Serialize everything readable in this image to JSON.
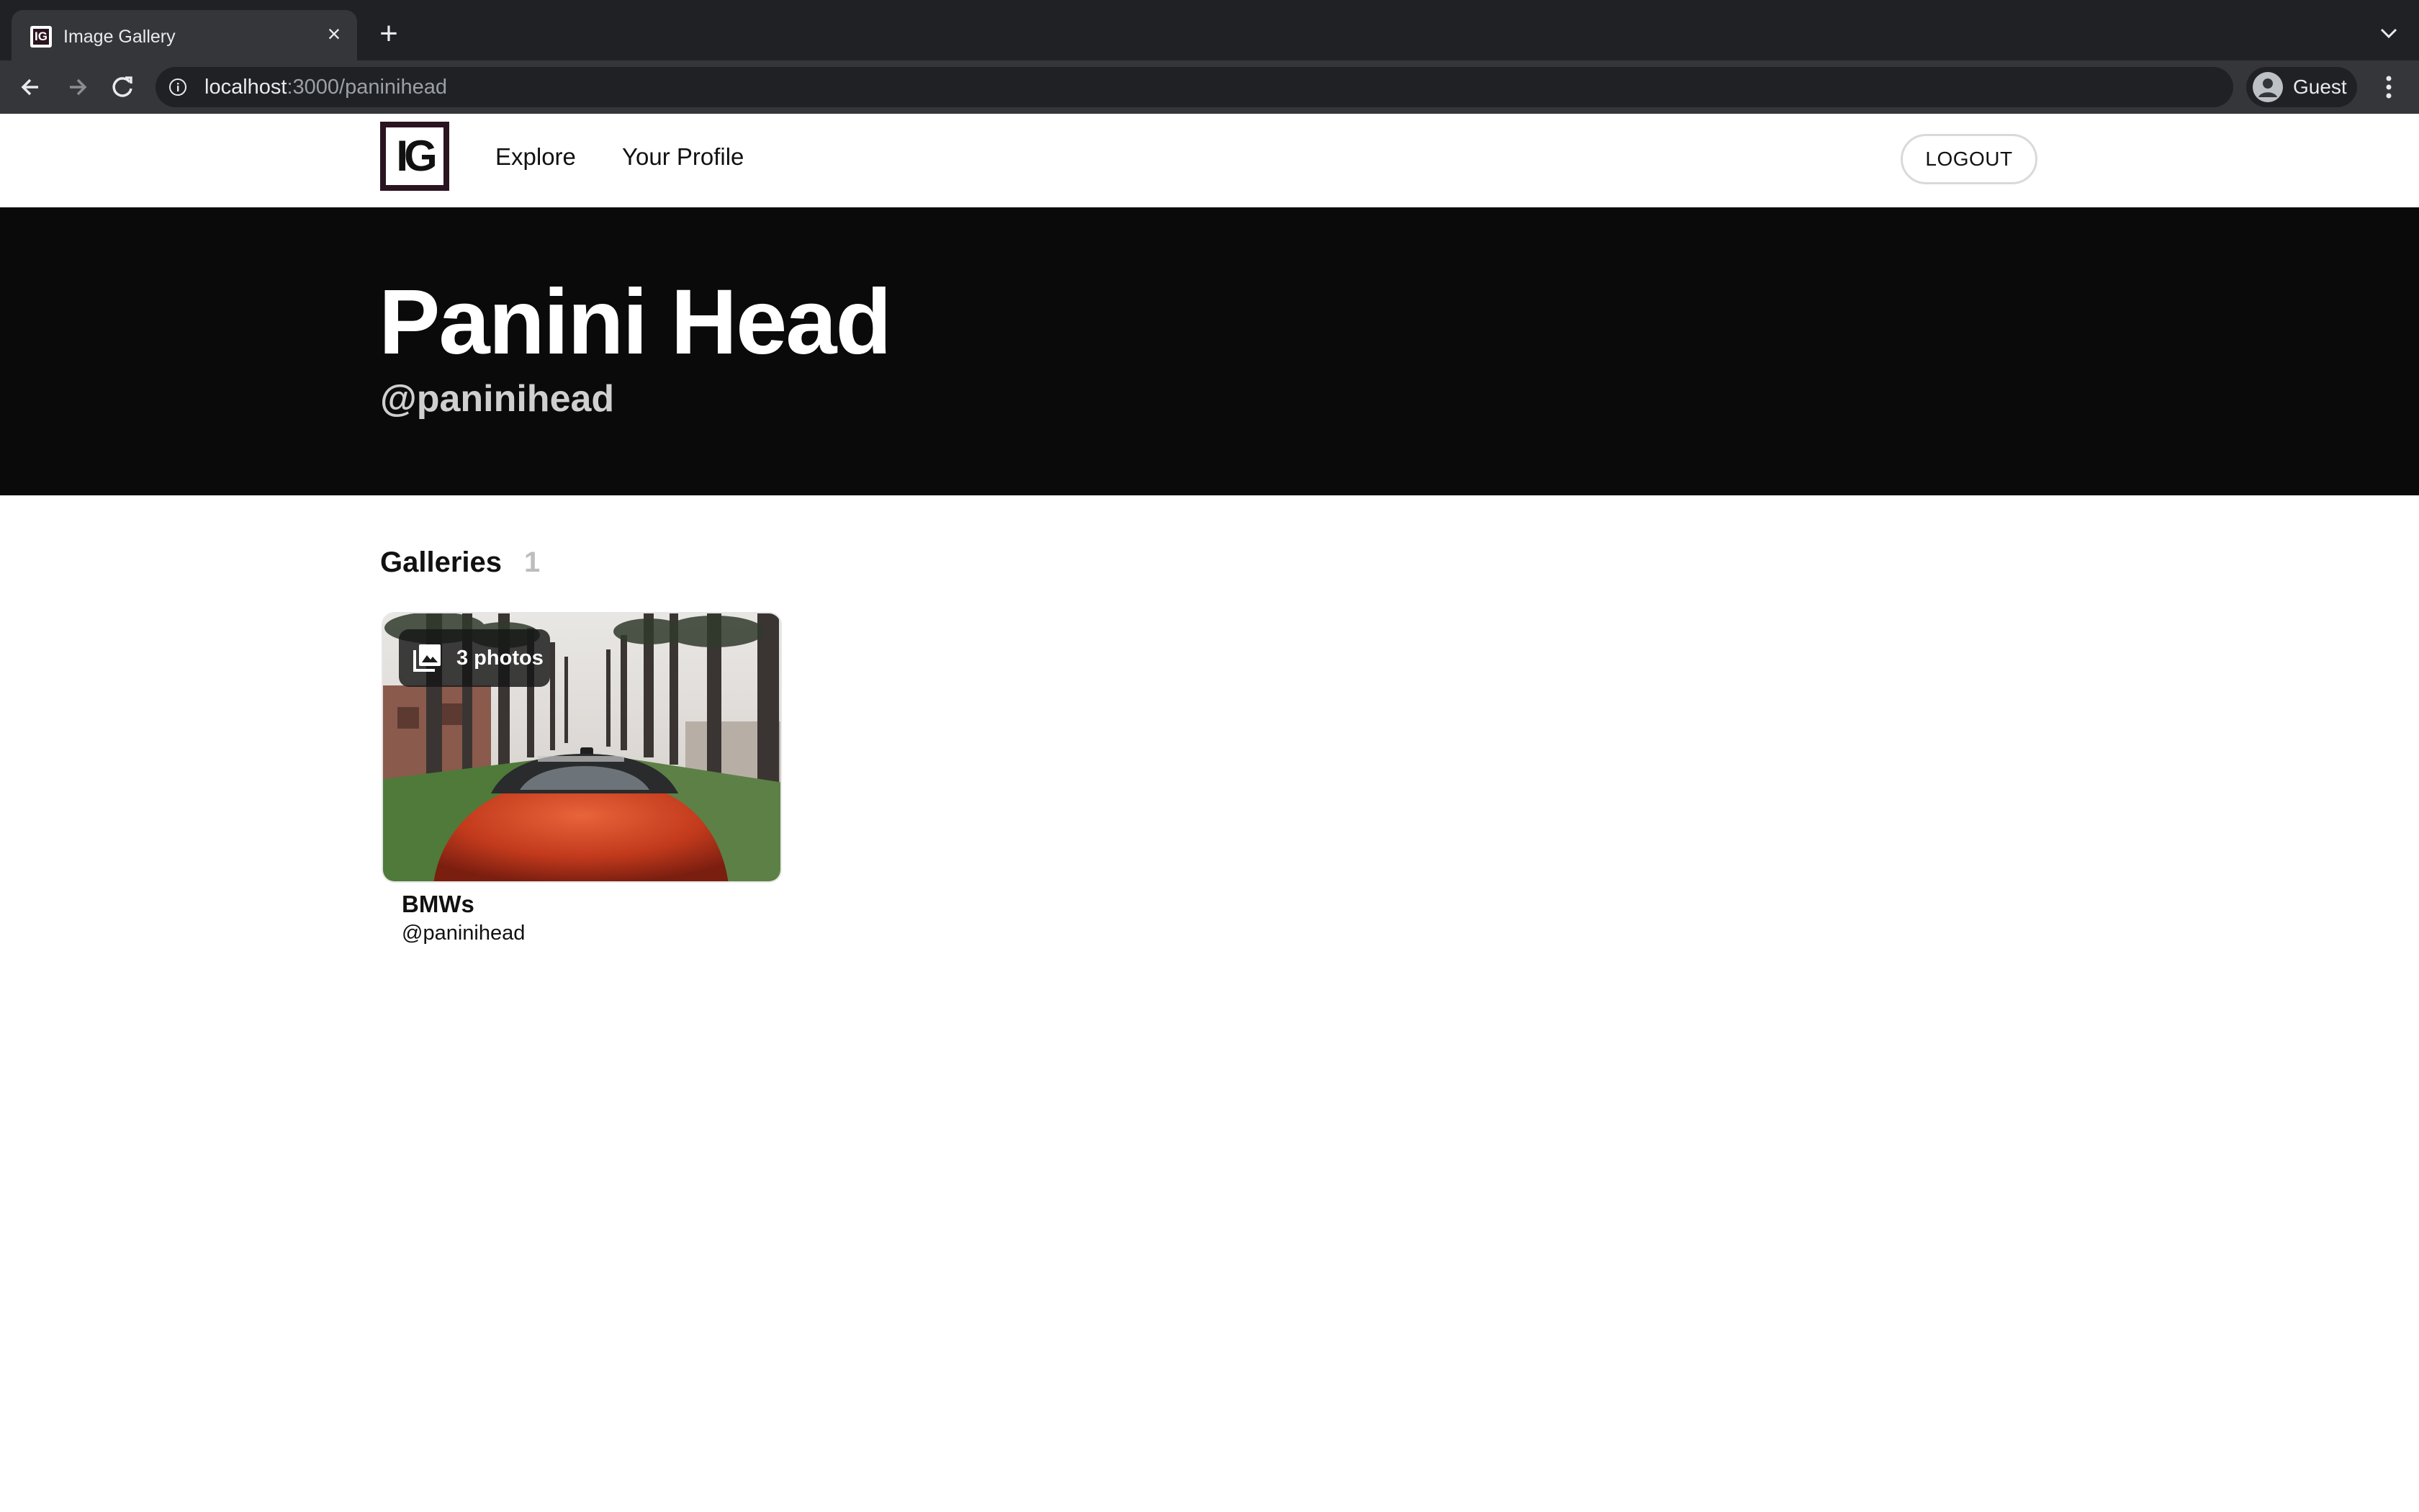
{
  "browser": {
    "tab_title": "Image Gallery",
    "tab_favicon_text": "IG",
    "url_host": "localhost",
    "url_rest": ":3000/paninihead",
    "profile_label": "Guest"
  },
  "header": {
    "logo_text": "IG",
    "nav": [
      {
        "label": "Explore"
      },
      {
        "label": "Your Profile"
      }
    ],
    "logout_label": "LOGOUT"
  },
  "profile": {
    "name": "Panini Head",
    "handle": "@paninihead"
  },
  "galleries": {
    "section_title": "Galleries",
    "count": "1",
    "items": [
      {
        "title": "BMWs",
        "owner": "@paninihead",
        "photo_count_label": "3 photos"
      }
    ]
  },
  "colors": {
    "hero_background": "#0b0a0b",
    "logo_frame": "#2a1420",
    "browser_tabstrip": "#202124",
    "browser_toolbar": "#35363a"
  },
  "icons": [
    "favicon-ig",
    "close-icon",
    "plus-icon",
    "chevron-down-icon",
    "back-arrow-icon",
    "forward-arrow-icon",
    "reload-icon",
    "info-icon",
    "avatar-icon",
    "kebab-menu-icon",
    "photo-library-icon"
  ]
}
